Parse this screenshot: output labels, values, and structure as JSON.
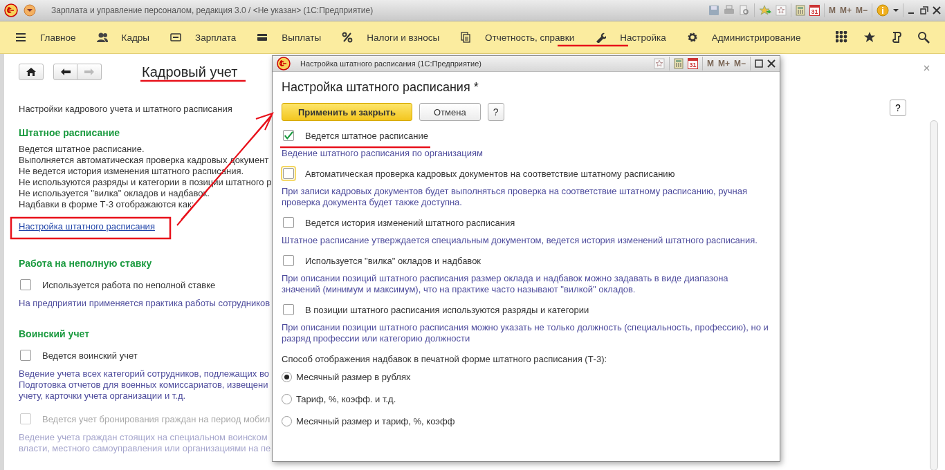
{
  "window": {
    "title": "Зарплата и управление персоналом, редакция 3.0 / <Не указан>  (1С:Предприятие)",
    "calendar_day": "31",
    "memory_keys": [
      "M",
      "M+",
      "M−"
    ]
  },
  "sections": [
    {
      "label": "Главное",
      "kind": "menu"
    },
    {
      "label": "Кадры",
      "kind": "people"
    },
    {
      "label": "Зарплата",
      "kind": "card"
    },
    {
      "label": "Выплаты",
      "kind": "wallet"
    },
    {
      "label": "Налоги и взносы",
      "kind": "percent"
    },
    {
      "label": "Отчетность, справки",
      "kind": "documents"
    },
    {
      "label": "Настройка",
      "kind": "wrench"
    },
    {
      "label": "Администрирование",
      "kind": "gear"
    }
  ],
  "page": {
    "title": "Кадровый учет",
    "help": "?",
    "items": [
      {
        "kind": "text",
        "lines": [
          "Настройки кадрового учета и штатного расписания"
        ]
      },
      {
        "kind": "heading",
        "text": "Штатное расписание"
      },
      {
        "kind": "lines",
        "lines": [
          "Ведется штатное расписание.",
          "Выполняется автоматическая проверка кадровых документ",
          "Не ведется история изменения штатного расписания.",
          "Не используются разряды и категории в позиции штатного р",
          "Не используется \"вилка\" окладов и надбавок.",
          "Надбавки в форме Т-3 отображаются как:"
        ]
      },
      {
        "kind": "link",
        "text": "Настройка штатного расписания"
      },
      {
        "kind": "heading",
        "text": "Работа на неполную ставку"
      },
      {
        "kind": "checkbox",
        "label": "Используется работа по неполной ставке",
        "checked": false,
        "disabled": false
      },
      {
        "kind": "note",
        "lines": [
          "На предприятии применяется практика работы сотрудников"
        ],
        "disabled": false
      },
      {
        "kind": "heading",
        "text": "Воинский учет"
      },
      {
        "kind": "checkbox",
        "label": "Ведется воинский учет",
        "checked": false,
        "disabled": false
      },
      {
        "kind": "note",
        "lines": [
          "Ведение учета всех категорий сотрудников, подлежащих во",
          "Подготовка отчетов для военных комиссариатов, извещени",
          "учету, карточки учета организации и т.д."
        ],
        "disabled": false
      },
      {
        "kind": "checkbox",
        "label": "Ведется учет бронирования граждан на период мобил",
        "checked": false,
        "disabled": true
      },
      {
        "kind": "note",
        "lines": [
          "Ведение учета граждан стоящих на специальном воинском",
          "власти, местного самоуправления или организациями на пе"
        ],
        "disabled": true
      }
    ]
  },
  "dialog": {
    "title": "Настройка штатного расписания  (1С:Предприятие)",
    "calendar_day": "31",
    "memory_keys": [
      "M",
      "M+",
      "M−"
    ],
    "heading": "Настройка штатного расписания *",
    "buttons": [
      {
        "label": "Применить и закрыть",
        "kind": "primary"
      },
      {
        "label": "Отмена",
        "kind": "normal"
      },
      {
        "label": "?",
        "kind": "help"
      }
    ],
    "items": [
      {
        "kind": "checkbox",
        "label": "Ведется штатное расписание",
        "checked": true,
        "disabled": false,
        "focused": false
      },
      {
        "kind": "note",
        "lines": [
          "Ведение штатного расписания по организациям"
        ],
        "disabled": false
      },
      {
        "kind": "checkbox",
        "label": "Автоматическая проверка кадровых документов на соответствие штатному расписанию",
        "checked": false,
        "disabled": false,
        "focused": true
      },
      {
        "kind": "note",
        "lines": [
          "При записи кадровых документов будет выполняться проверка на соответствие штатному расписанию, ручная",
          "проверка документа будет также доступна."
        ],
        "disabled": false
      },
      {
        "kind": "checkbox",
        "label": "Ведется история изменений штатного расписания",
        "checked": false,
        "disabled": false,
        "focused": false
      },
      {
        "kind": "note",
        "lines": [
          "Штатное расписание утверждается специальным документом, ведется история изменений штатного расписания."
        ],
        "disabled": false
      },
      {
        "kind": "checkbox",
        "label": "Используется \"вилка\" окладов и надбавок",
        "checked": false,
        "disabled": false,
        "focused": false
      },
      {
        "kind": "note",
        "lines": [
          "При описании позиций штатного расписания размер оклада и надбавок можно задавать в виде диапазона",
          "значений (минимум и максимум), что на практике часто называют \"вилкой\" окладов."
        ],
        "disabled": false
      },
      {
        "kind": "checkbox",
        "label": "В позиции штатного расписания используются разряды и категории",
        "checked": false,
        "disabled": false,
        "focused": false
      },
      {
        "kind": "note",
        "lines": [
          "При описании позиции штатного расписания можно указать не только должность (специальность, профессию), но и",
          "разряд профессии или категорию должности"
        ],
        "disabled": false
      },
      {
        "kind": "text",
        "lines": [
          "Способ отображения надбавок в печатной форме штатного расписания (Т-3):"
        ]
      },
      {
        "kind": "radio",
        "label": "Месячный размер в рублях",
        "selected": true
      },
      {
        "kind": "radio",
        "label": "Тариф, %, коэфф. и т.д.",
        "selected": false
      },
      {
        "kind": "radio",
        "label": "Месячный размер и тариф, %, коэфф",
        "selected": false
      }
    ]
  }
}
